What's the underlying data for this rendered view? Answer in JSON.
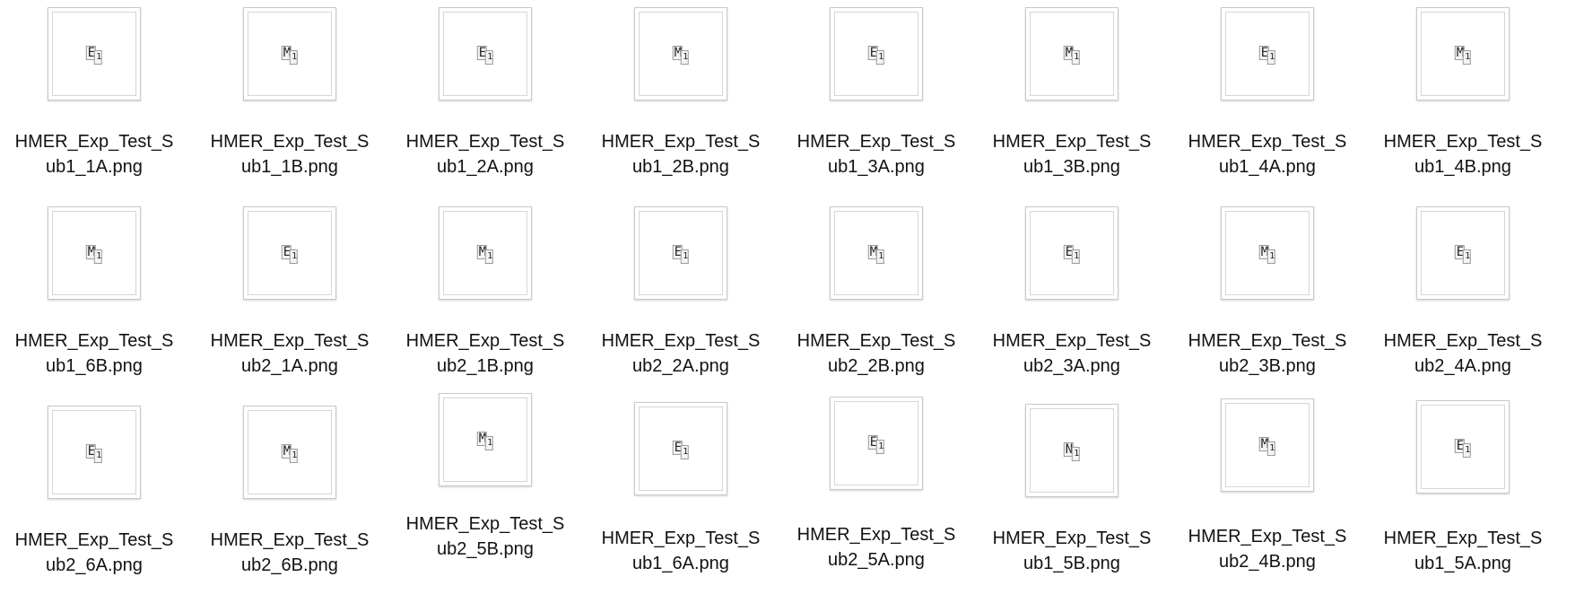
{
  "files": [
    {
      "line1": "HMER_Exp_Test_S",
      "line2": "ub1_1A.png",
      "glyph_main": "E",
      "glyph_sub": "1"
    },
    {
      "line1": "HMER_Exp_Test_S",
      "line2": "ub1_1B.png",
      "glyph_main": "M",
      "glyph_sub": "1"
    },
    {
      "line1": "HMER_Exp_Test_S",
      "line2": "ub1_2A.png",
      "glyph_main": "E",
      "glyph_sub": "1"
    },
    {
      "line1": "HMER_Exp_Test_S",
      "line2": "ub1_2B.png",
      "glyph_main": "M",
      "glyph_sub": "1"
    },
    {
      "line1": "HMER_Exp_Test_S",
      "line2": "ub1_3A.png",
      "glyph_main": "E",
      "glyph_sub": "1"
    },
    {
      "line1": "HMER_Exp_Test_S",
      "line2": "ub1_3B.png",
      "glyph_main": "M",
      "glyph_sub": "1"
    },
    {
      "line1": "HMER_Exp_Test_S",
      "line2": "ub1_4A.png",
      "glyph_main": "E",
      "glyph_sub": "1"
    },
    {
      "line1": "HMER_Exp_Test_S",
      "line2": "ub1_4B.png",
      "glyph_main": "M",
      "glyph_sub": "1"
    },
    {
      "line1": "HMER_Exp_Test_S",
      "line2": "ub1_6B.png",
      "glyph_main": "M",
      "glyph_sub": "1"
    },
    {
      "line1": "HMER_Exp_Test_S",
      "line2": "ub2_1A.png",
      "glyph_main": "E",
      "glyph_sub": "1"
    },
    {
      "line1": "HMER_Exp_Test_S",
      "line2": "ub2_1B.png",
      "glyph_main": "M",
      "glyph_sub": "1"
    },
    {
      "line1": "HMER_Exp_Test_S",
      "line2": "ub2_2A.png",
      "glyph_main": "E",
      "glyph_sub": "1"
    },
    {
      "line1": "HMER_Exp_Test_S",
      "line2": "ub2_2B.png",
      "glyph_main": "M",
      "glyph_sub": "1"
    },
    {
      "line1": "HMER_Exp_Test_S",
      "line2": "ub2_3A.png",
      "glyph_main": "E",
      "glyph_sub": "1"
    },
    {
      "line1": "HMER_Exp_Test_S",
      "line2": "ub2_3B.png",
      "glyph_main": "M",
      "glyph_sub": "1"
    },
    {
      "line1": "HMER_Exp_Test_S",
      "line2": "ub2_4A.png",
      "glyph_main": "E",
      "glyph_sub": "1"
    },
    {
      "line1": "HMER_Exp_Test_S",
      "line2": "ub2_6A.png",
      "glyph_main": "E",
      "glyph_sub": "1"
    },
    {
      "line1": "HMER_Exp_Test_S",
      "line2": "ub2_6B.png",
      "glyph_main": "M",
      "glyph_sub": "1"
    },
    {
      "line1": "HMER_Exp_Test_S",
      "line2": "ub2_5B.png",
      "glyph_main": "M",
      "glyph_sub": "1"
    },
    {
      "line1": "HMER_Exp_Test_S",
      "line2": "ub1_6A.png",
      "glyph_main": "E",
      "glyph_sub": "1"
    },
    {
      "line1": "HMER_Exp_Test_S",
      "line2": "ub2_5A.png",
      "glyph_main": "E",
      "glyph_sub": "1"
    },
    {
      "line1": "HMER_Exp_Test_S",
      "line2": "ub1_5B.png",
      "glyph_main": "N",
      "glyph_sub": "1"
    },
    {
      "line1": "HMER_Exp_Test_S",
      "line2": "ub2_4B.png",
      "glyph_main": "M",
      "glyph_sub": "1"
    },
    {
      "line1": "HMER_Exp_Test_S",
      "line2": "ub1_5A.png",
      "glyph_main": "E",
      "glyph_sub": "1"
    }
  ]
}
